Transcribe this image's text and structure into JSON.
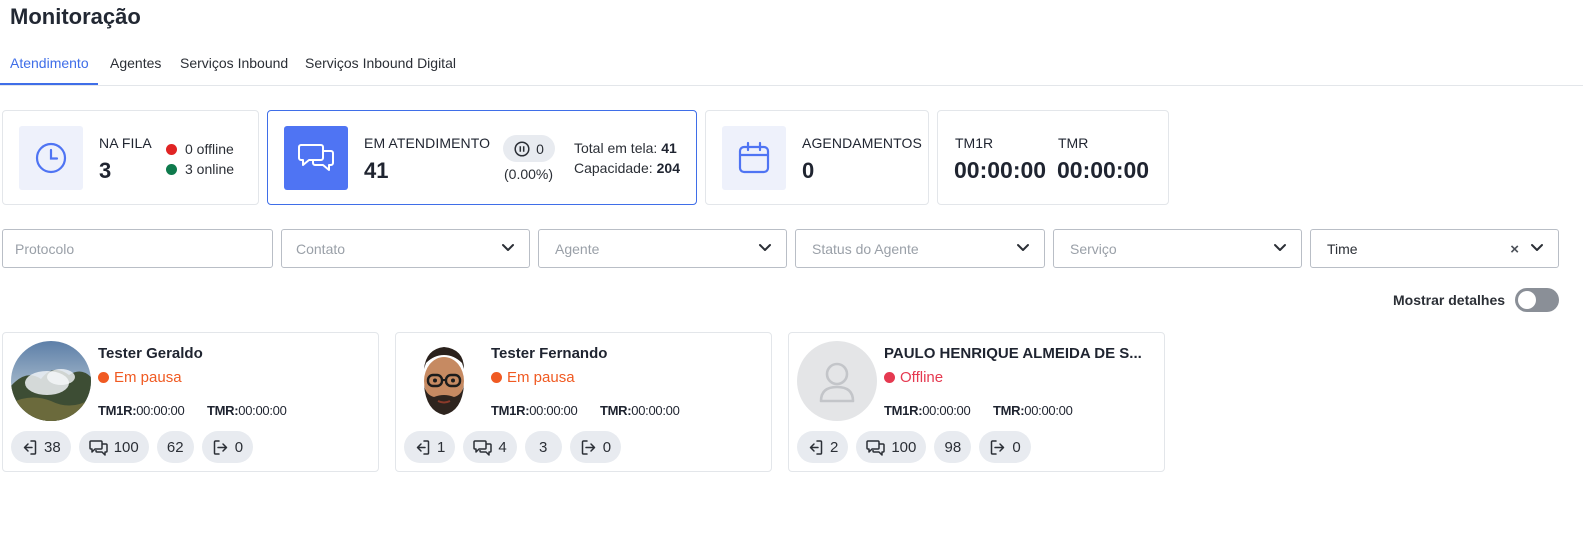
{
  "page": {
    "title": "Monitoração"
  },
  "tabs": [
    {
      "label": "Atendimento",
      "active": true
    },
    {
      "label": "Agentes",
      "active": false
    },
    {
      "label": "Serviços Inbound",
      "active": false
    },
    {
      "label": "Serviços Inbound Digital",
      "active": false
    }
  ],
  "stats": {
    "queue": {
      "label": "NA FILA",
      "value": "3",
      "offline": "0 offline",
      "online": "3 online"
    },
    "in_service": {
      "label": "EM ATENDIMENTO",
      "value": "41",
      "paused": "0",
      "paused_pct": "(0.00%)",
      "total_label": "Total em tela:",
      "total_value": "41",
      "capacity_label": "Capacidade:",
      "capacity_value": "204"
    },
    "schedules": {
      "label": "AGENDAMENTOS",
      "value": "0"
    },
    "times": {
      "tm1r_label": "TM1R",
      "tm1r_value": "00:00:00",
      "tmr_label": "TMR",
      "tmr_value": "00:00:00"
    }
  },
  "filters": {
    "protocol_placeholder": "Protocolo",
    "contact_placeholder": "Contato",
    "agent_placeholder": "Agente",
    "agent_status_placeholder": "Status do Agente",
    "service_placeholder": "Serviço",
    "team_value": "Time"
  },
  "details_toggle": {
    "label": "Mostrar detalhes",
    "on": false
  },
  "agents": [
    {
      "name": "Tester Geraldo",
      "status": "Em pausa",
      "tm1r_label": "TM1R:",
      "tm1r": "00:00:00",
      "tmr_label": "TMR:",
      "tmr": "00:00:00",
      "logins": "38",
      "chats": "100",
      "count": "62",
      "logouts": "0"
    },
    {
      "name": "Tester Fernando",
      "status": "Em pausa",
      "tm1r_label": "TM1R:",
      "tm1r": "00:00:00",
      "tmr_label": "TMR:",
      "tmr": "00:00:00",
      "logins": "1",
      "chats": "4",
      "count": "3",
      "logouts": "0"
    },
    {
      "name": "PAULO HENRIQUE ALMEIDA DE S...",
      "status": "Offline",
      "tm1r_label": "TM1R:",
      "tm1r": "00:00:00",
      "tmr_label": "TMR:",
      "tmr": "00:00:00",
      "logins": "2",
      "chats": "100",
      "count": "98",
      "logouts": "0"
    }
  ],
  "colors": {
    "accent": "#3f6ee8",
    "accent_solid": "#4f74f3",
    "offline_dot": "#e02424",
    "online_dot": "#0e7a4c",
    "paused": "#f05a22",
    "agent_offline": "#e53950"
  }
}
